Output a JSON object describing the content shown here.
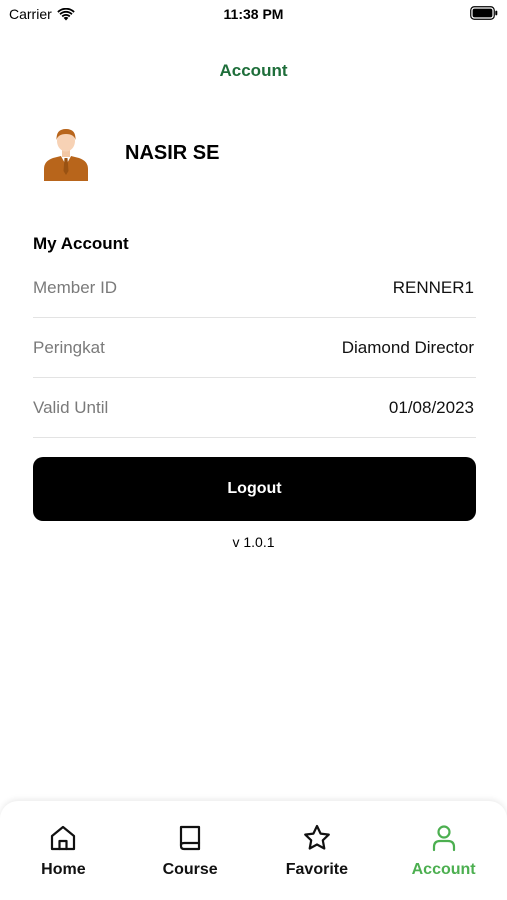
{
  "status_bar": {
    "carrier": "Carrier",
    "time": "11:38 PM"
  },
  "header": {
    "title": "Account",
    "title_color": "#1e6e3a"
  },
  "profile": {
    "name": "NASIR SE",
    "avatar_icon": "businessman-avatar-icon"
  },
  "my_account": {
    "title": "My Account",
    "rows": [
      {
        "label": "Member ID",
        "value": "RENNER1"
      },
      {
        "label": "Peringkat",
        "value": "Diamond Director"
      },
      {
        "label": "Valid Until",
        "value": "01/08/2023"
      }
    ]
  },
  "logout_label": "Logout",
  "version": "v 1.0.1",
  "tabs": [
    {
      "label": "Home",
      "icon": "home-icon",
      "active": false
    },
    {
      "label": "Course",
      "icon": "book-icon",
      "active": false
    },
    {
      "label": "Favorite",
      "icon": "star-icon",
      "active": false
    },
    {
      "label": "Account",
      "icon": "user-icon",
      "active": true
    }
  ],
  "colors": {
    "accent": "#4caf50",
    "button": "#000000",
    "avatar": "#b8651b"
  }
}
